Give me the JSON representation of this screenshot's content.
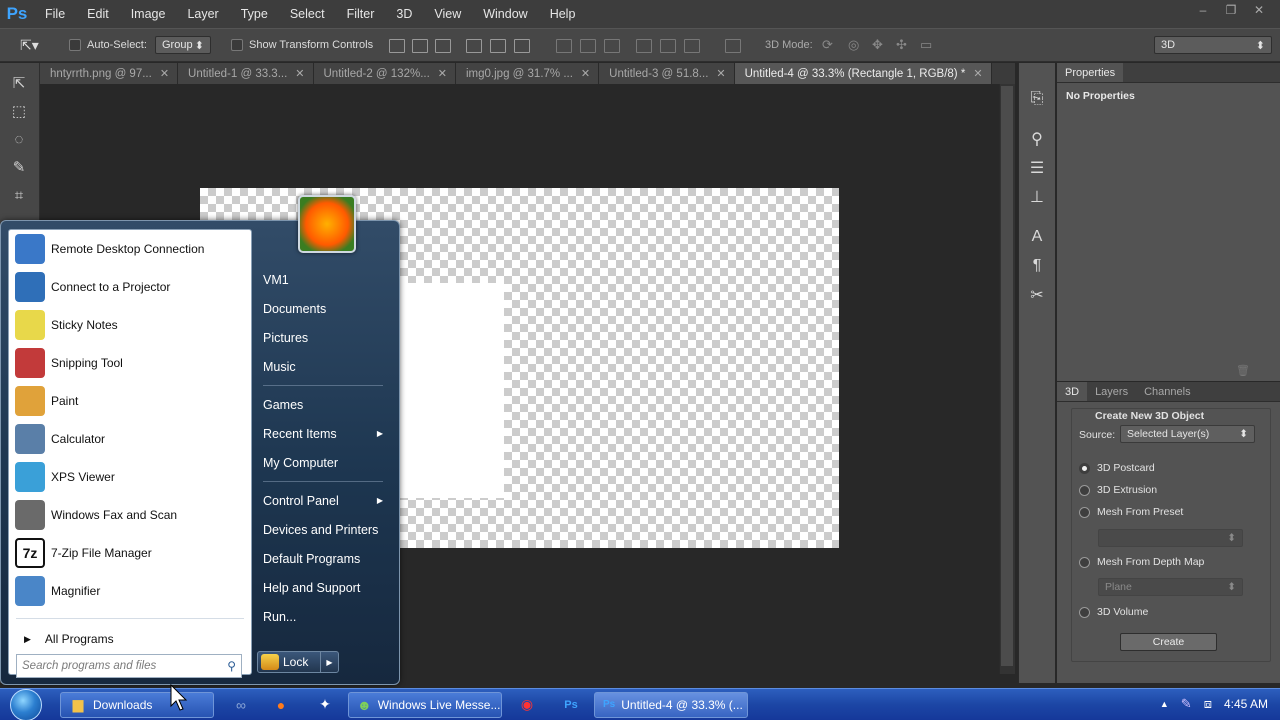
{
  "app": {
    "logo": "Ps"
  },
  "menubar": {
    "items": [
      "File",
      "Edit",
      "Image",
      "Layer",
      "Type",
      "Select",
      "Filter",
      "3D",
      "View",
      "Window",
      "Help"
    ]
  },
  "window_controls": {
    "minimize": "–",
    "restore": "❐",
    "close": "✕"
  },
  "options_bar": {
    "auto_select_label": "Auto-Select:",
    "auto_select_value": "Group",
    "transform_label": "Show Transform Controls",
    "mode_label": "3D Mode:",
    "workspace_value": "3D"
  },
  "doc_tabs": [
    {
      "label": "hntyrrth.png @ 97...",
      "active": false
    },
    {
      "label": "Untitled-1 @ 33.3...",
      "active": false
    },
    {
      "label": "Untitled-2 @ 132%...",
      "active": false
    },
    {
      "label": "img0.jpg @ 31.7% ...",
      "active": false
    },
    {
      "label": "Untitled-3 @ 51.8...",
      "active": false
    },
    {
      "label": "Untitled-4 @ 33.3% (Rectangle 1, RGB/8) *",
      "active": true
    }
  ],
  "properties_panel": {
    "tab": "Properties",
    "content": "No Properties"
  },
  "panel_3d": {
    "tabs": [
      "3D",
      "Layers",
      "Channels"
    ],
    "heading": "Create New 3D Object",
    "source_label": "Source:",
    "source_value": "Selected Layer(s)",
    "options": [
      {
        "label": "3D Postcard",
        "selected": true
      },
      {
        "label": "3D Extrusion",
        "selected": false
      },
      {
        "label": "Mesh From Preset",
        "selected": false
      },
      {
        "label": "Mesh From Depth Map",
        "selected": false
      },
      {
        "label": "3D Volume",
        "selected": false
      }
    ],
    "depth_map_value": "Plane",
    "create_label": "Create"
  },
  "start_menu": {
    "programs": [
      {
        "label": "Remote Desktop Connection",
        "icon": "remote-desktop-icon",
        "color": "#3a78c8"
      },
      {
        "label": "Connect to a Projector",
        "icon": "projector-icon",
        "color": "#2f6fb8"
      },
      {
        "label": "Sticky Notes",
        "icon": "sticky-notes-icon",
        "color": "#e8d84a"
      },
      {
        "label": "Snipping Tool",
        "icon": "snipping-tool-icon",
        "color": "#c23a3a"
      },
      {
        "label": "Paint",
        "icon": "paint-icon",
        "color": "#e0a23a"
      },
      {
        "label": "Calculator",
        "icon": "calculator-icon",
        "color": "#5a7fa8"
      },
      {
        "label": "XPS Viewer",
        "icon": "xps-viewer-icon",
        "color": "#3aa0d8"
      },
      {
        "label": "Windows Fax and Scan",
        "icon": "fax-scan-icon",
        "color": "#6a6a6a"
      },
      {
        "label": "7-Zip File Manager",
        "icon": "seven-zip-icon",
        "color": "#111111",
        "glyph": "7z"
      },
      {
        "label": "Magnifier",
        "icon": "magnifier-icon",
        "color": "#4a86c8"
      }
    ],
    "all_programs": "All Programs",
    "search_placeholder": "Search programs and files",
    "right_items": [
      {
        "label": "VM1",
        "arrow": false
      },
      {
        "label": "Documents",
        "arrow": false
      },
      {
        "label": "Pictures",
        "arrow": false
      },
      {
        "label": "Music",
        "arrow": false
      },
      {
        "sep": true
      },
      {
        "label": "Games",
        "arrow": false
      },
      {
        "label": "Recent Items",
        "arrow": true
      },
      {
        "label": "My Computer",
        "arrow": false
      },
      {
        "sep": true
      },
      {
        "label": "Control Panel",
        "arrow": true
      },
      {
        "label": "Devices and Printers",
        "arrow": false
      },
      {
        "label": "Default Programs",
        "arrow": false
      },
      {
        "label": "Help and Support",
        "arrow": false
      },
      {
        "label": "Run...",
        "arrow": false
      }
    ],
    "lock_label": "Lock"
  },
  "taskbar": {
    "downloads_label": "Downloads",
    "messenger_label": "Windows Live Messe...",
    "photoshop_label": "Untitled-4 @ 33.3% (...",
    "clock": "4:45 AM"
  },
  "colors": {
    "ps_blue": "#3ea4ff",
    "taskbar_blue": "#1c46a5"
  }
}
